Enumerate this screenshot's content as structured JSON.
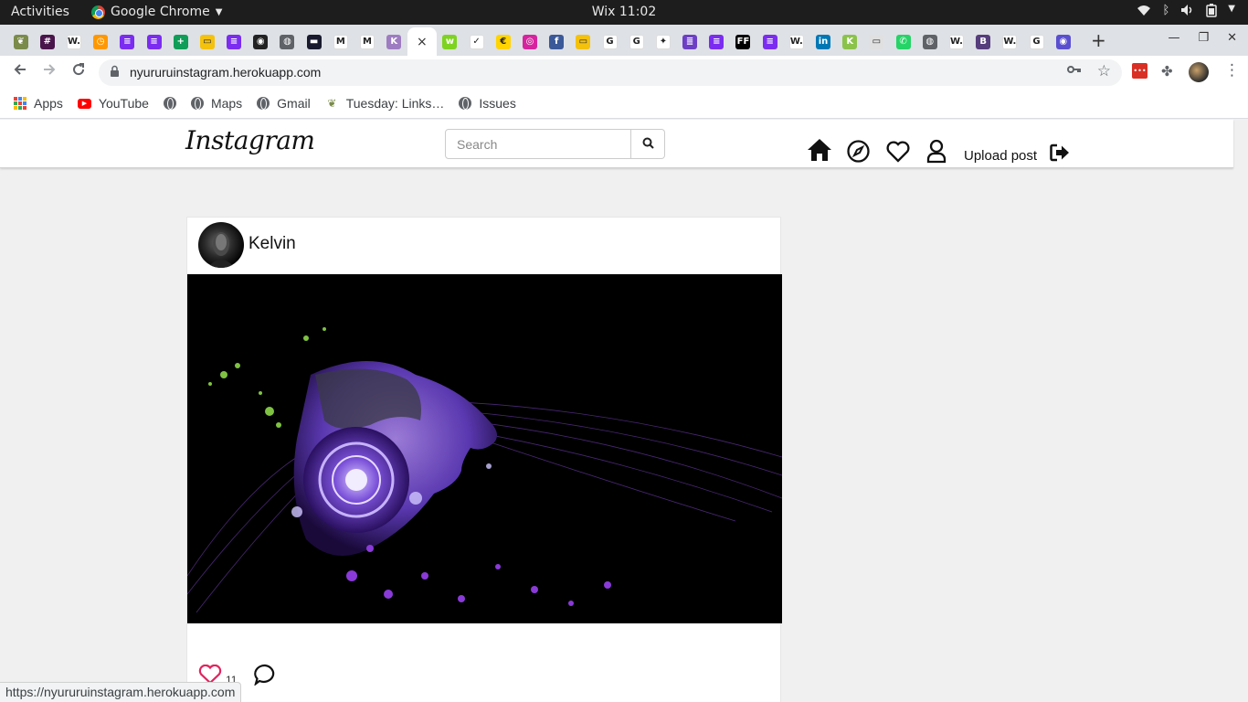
{
  "system_bar": {
    "activities": "Activities",
    "app_name": "Google Chrome",
    "clock": "Wix 11:02"
  },
  "browser": {
    "url": "nyururuinstagram.herokuapp.com",
    "status_url": "https://nyururuinstagram.herokuapp.com",
    "tabs": [
      {
        "icon": "plant-icon",
        "color": "#7a8b4a",
        "glyph": "❦"
      },
      {
        "icon": "slack-icon",
        "color": "#4a154b",
        "glyph": "#"
      },
      {
        "icon": "wix-icon",
        "color": "#ffffff",
        "glyph": "W."
      },
      {
        "icon": "clock-app-icon",
        "color": "#ff9800",
        "glyph": "◷"
      },
      {
        "icon": "docs-icon",
        "color": "#7b2cf0",
        "glyph": "≡"
      },
      {
        "icon": "docs-icon",
        "color": "#7b2cf0",
        "glyph": "≡"
      },
      {
        "icon": "sheets-icon",
        "color": "#0f9d58",
        "glyph": "+"
      },
      {
        "icon": "slides-icon",
        "color": "#f4c20d",
        "glyph": "▭"
      },
      {
        "icon": "docs-icon",
        "color": "#7b2cf0",
        "glyph": "≡"
      },
      {
        "icon": "github-icon",
        "color": "#222222",
        "glyph": "◉"
      },
      {
        "icon": "globe-icon",
        "color": "#5f6368",
        "glyph": "◍"
      },
      {
        "icon": "app-icon",
        "color": "#1a1a2e",
        "glyph": "▬"
      },
      {
        "icon": "gmail-icon",
        "color": "#ffffff",
        "glyph": "M"
      },
      {
        "icon": "gmail-icon",
        "color": "#ffffff",
        "glyph": "M"
      },
      {
        "icon": "heroku-icon",
        "color": "#9e7cc1",
        "glyph": "K"
      },
      {
        "icon": "close-icon",
        "color": "#ffffff",
        "glyph": "×"
      },
      {
        "icon": "wakatime-icon",
        "color": "#7ed321",
        "glyph": "w"
      },
      {
        "icon": "bird-icon",
        "color": "#ffffff",
        "glyph": "✓"
      },
      {
        "icon": "coin-icon",
        "color": "#ffd400",
        "glyph": "€"
      },
      {
        "icon": "instagram-icon",
        "color": "#d6249f",
        "glyph": "◎"
      },
      {
        "icon": "facebook-icon",
        "color": "#3b5998",
        "glyph": "f"
      },
      {
        "icon": "slides-icon",
        "color": "#f4c20d",
        "glyph": "▭"
      },
      {
        "icon": "google-icon",
        "color": "#ffffff",
        "glyph": "G"
      },
      {
        "icon": "gc-icon",
        "color": "#ffffff",
        "glyph": "G"
      },
      {
        "icon": "figma-icon",
        "color": "#ffffff",
        "glyph": "✦"
      },
      {
        "icon": "db-icon",
        "color": "#6c3fc5",
        "glyph": "≣"
      },
      {
        "icon": "docs-icon",
        "color": "#7b2cf0",
        "glyph": "≡"
      },
      {
        "icon": "ff-icon",
        "color": "#000000",
        "glyph": "FF"
      },
      {
        "icon": "docs-icon",
        "color": "#7b2cf0",
        "glyph": "≡"
      },
      {
        "icon": "wix-icon",
        "color": "#ffffff",
        "glyph": "W."
      },
      {
        "icon": "linkedin-icon",
        "color": "#0077b5",
        "glyph": "in"
      },
      {
        "icon": "k-icon",
        "color": "#8bc34a",
        "glyph": "K"
      },
      {
        "icon": "image-icon",
        "color": "#e0e0e0",
        "glyph": "▭"
      },
      {
        "icon": "whatsapp-icon",
        "color": "#25d366",
        "glyph": "✆"
      },
      {
        "icon": "globe-icon",
        "color": "#5f6368",
        "glyph": "◍"
      },
      {
        "icon": "wix-icon",
        "color": "#ffffff",
        "glyph": "W."
      },
      {
        "icon": "bootstrap-icon",
        "color": "#563d7c",
        "glyph": "B"
      },
      {
        "icon": "wix-icon",
        "color": "#ffffff",
        "glyph": "W."
      },
      {
        "icon": "google-icon",
        "color": "#ffffff",
        "glyph": "G"
      },
      {
        "icon": "eye-icon",
        "color": "#5a4fcf",
        "glyph": "◉"
      }
    ],
    "bookmarks": [
      {
        "label": "Apps",
        "icon": "apps-grid-icon"
      },
      {
        "label": "YouTube",
        "icon": "youtube-icon"
      },
      {
        "label": "",
        "icon": "globe-icon"
      },
      {
        "label": "Maps",
        "icon": "globe-icon"
      },
      {
        "label": "Gmail",
        "icon": "globe-icon"
      },
      {
        "label": "Tuesday: Links…",
        "icon": "plant-icon"
      },
      {
        "label": "Issues",
        "icon": "globe-icon"
      }
    ]
  },
  "app": {
    "logo": "Instagram",
    "search_placeholder": "Search",
    "upload_label": "Upload post",
    "post": {
      "username": "Kelvin",
      "likes": "11"
    }
  },
  "colors": {
    "header_bg": "#ffffff",
    "page_bg": "#f0f0f0",
    "like_red": "#e0245e"
  }
}
